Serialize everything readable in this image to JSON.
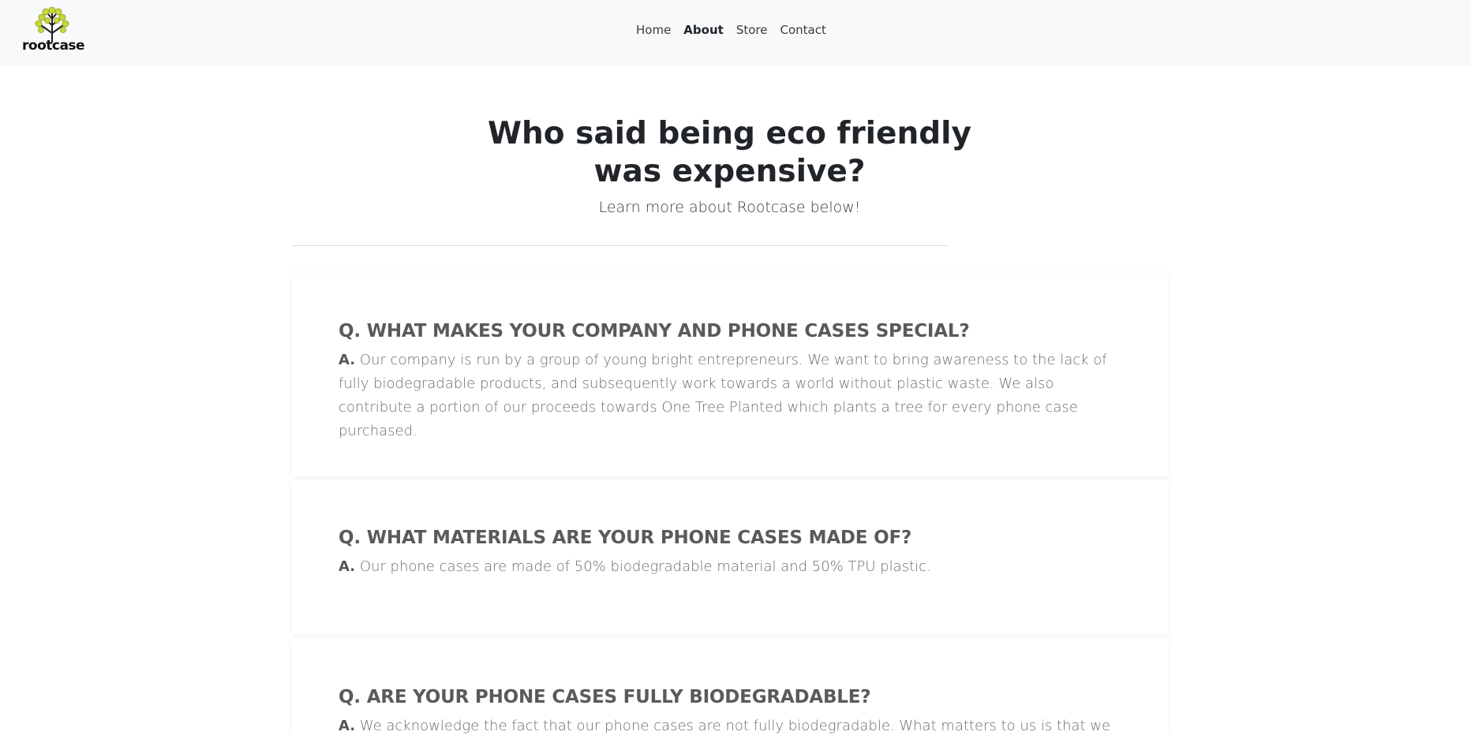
{
  "brand": {
    "name": "rootcase"
  },
  "nav": {
    "items": [
      "Home",
      "About",
      "Store",
      "Contact"
    ],
    "active": "About"
  },
  "hero": {
    "title_line1": "Who said being eco friendly",
    "title_line2": "was expensive?",
    "subtitle": "Learn more about Rootcase below!"
  },
  "faq": [
    {
      "question_prefix": "Q.",
      "question": "WHAT MAKES YOUR COMPANY AND PHONE CASES SPECIAL?",
      "answer_prefix": "A.",
      "answer": "Our company is run by a group of young bright entrepreneurs. We want to bring awareness to the lack of fully biodegradable products, and subsequently work towards a world without plastic waste. We also contribute a portion of our proceeds towards One Tree Planted which plants a tree for every phone case purchased."
    },
    {
      "question_prefix": "Q.",
      "question": "WHAT MATERIALS ARE YOUR PHONE CASES MADE OF?",
      "answer_prefix": "A.",
      "answer": "Our phone cases are made of 50% biodegradable material and 50% TPU plastic."
    },
    {
      "question_prefix": "Q.",
      "question": "ARE YOUR PHONE CASES FULLY BIODEGRADABLE?",
      "answer_prefix": "A.",
      "answer": "We acknowledge the fact that our phone cases are not fully biodegradable. What matters to us is that we are slowly"
    }
  ],
  "colors": {
    "navbar_bg": "#f8f9fa",
    "logo_leaf": "#c6d83a",
    "text_dark": "#212529",
    "question_text": "#5a5a5a",
    "answer_text": "#6c6c6c"
  }
}
